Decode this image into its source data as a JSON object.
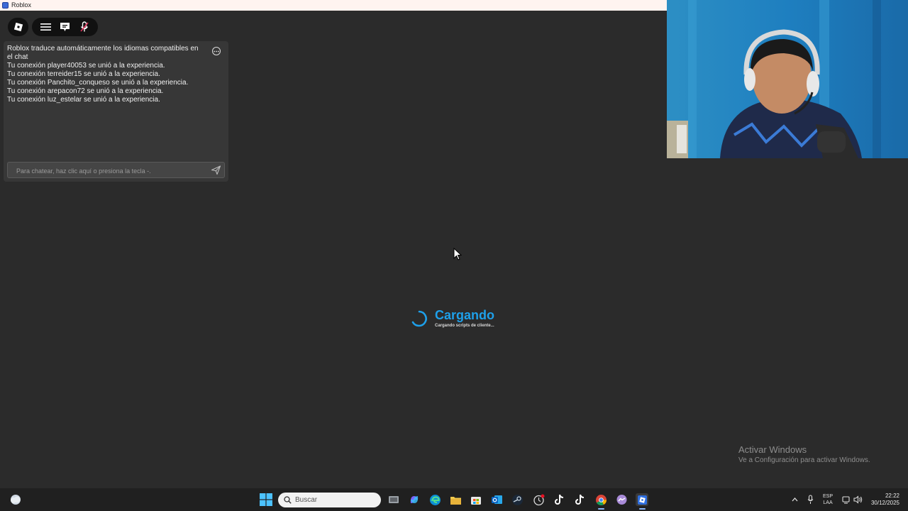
{
  "window": {
    "title": "Roblox"
  },
  "topbar": {
    "icons": [
      "roblox-logo-icon",
      "menu-icon",
      "chat-icon",
      "microphone-muted-icon"
    ]
  },
  "chat": {
    "messages": [
      "Roblox traduce automáticamente los idiomas compatibles en el chat",
      "Tu conexión player40053 se unió a la experiencia.",
      "Tu conexión terreider15 se unió a la experiencia.",
      "Tu conexión Panchito_conqueso se unió a la experiencia.",
      "Tu conexión arepacon72 se unió a la experiencia.",
      "Tu conexión luz_estelar se unió a la experiencia."
    ],
    "input_placeholder": "Para chatear, haz clic aquí o presiona la tecla -.",
    "input_value": ""
  },
  "loading": {
    "title": "Cargando",
    "subtitle": "Cargando scripts de cliente..."
  },
  "watermark": {
    "line1": "Activar Windows",
    "line2": "Ve a Configuración para activar Windows."
  },
  "taskbar": {
    "search_placeholder": "Buscar",
    "apps": [
      "task-view",
      "copilot",
      "edge",
      "file-explorer",
      "microsoft-store",
      "outlook",
      "steam",
      "app-clock",
      "tiktok",
      "tiktok-2",
      "chrome",
      "messenger",
      "roblox"
    ],
    "lang_line1": "ESP",
    "lang_line2": "LAA",
    "time": "22:22",
    "date": "30/12/2025"
  },
  "colors": {
    "background": "#2b2b2b",
    "accent": "#1ea0ea",
    "taskbar": "#202020"
  }
}
